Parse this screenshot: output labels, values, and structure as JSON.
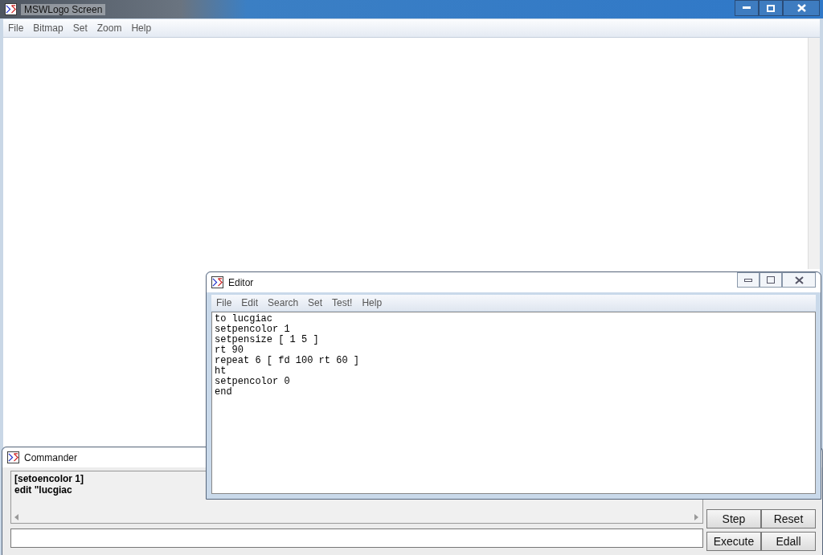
{
  "main_window": {
    "title": "MSWLogo Screen",
    "menu": [
      "File",
      "Bitmap",
      "Set",
      "Zoom",
      "Help"
    ]
  },
  "editor": {
    "title": "Editor",
    "menu": [
      "File",
      "Edit",
      "Search",
      "Set",
      "Test!",
      "Help"
    ],
    "lines": [
      "to lucgiac",
      "setpencolor 1",
      "setpensize [ 1 5 ]",
      "rt 90",
      "repeat 6 [ fd 100 rt 60 ]",
      "ht",
      "setpencolor 0",
      "end"
    ]
  },
  "commander": {
    "title": "Commander",
    "history": [
      "[setoencolor 1]",
      "edit \"lucgiac"
    ],
    "buttons": [
      "Step",
      "Reset",
      "Execute",
      "Edall"
    ]
  }
}
